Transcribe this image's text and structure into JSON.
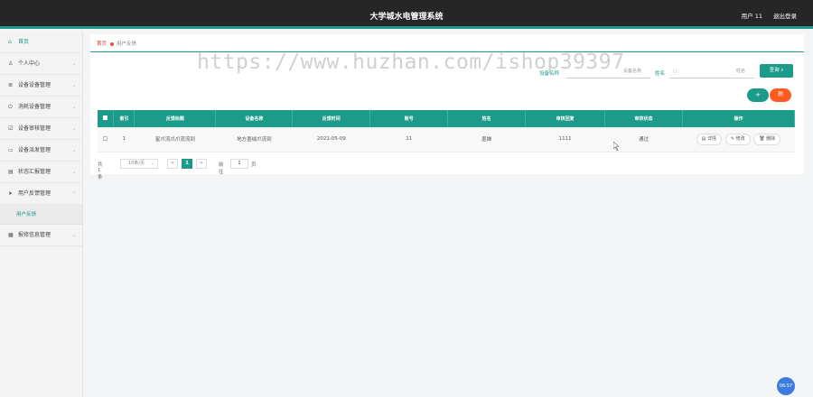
{
  "header": {
    "title": "大学城水电管理系统",
    "user": "用户 11",
    "logout": "退出登录"
  },
  "sidebar": {
    "items": [
      {
        "label": "首页",
        "icon": "home-icon"
      },
      {
        "label": "个人中心",
        "icon": "user-icon"
      },
      {
        "label": "设备设备管理",
        "icon": "list-icon"
      },
      {
        "label": "消耗设备管理",
        "icon": "power-icon"
      },
      {
        "label": "设备审核管理",
        "icon": "check-icon"
      },
      {
        "label": "设备派发管理",
        "icon": "device-icon"
      },
      {
        "label": "状态汇报管理",
        "icon": "report-icon"
      },
      {
        "label": "用户反馈管理",
        "icon": "send-icon"
      },
      {
        "label": "报修信息管理",
        "icon": "grid-icon"
      }
    ],
    "submenu": {
      "label": "用户反馈"
    }
  },
  "breadcrumb": {
    "home": "首页",
    "current": "用户反馈"
  },
  "filters": {
    "device_label": "设备名称",
    "device_placeholder": "设备名称",
    "name_label": "姓名",
    "name_placeholder": "姓名",
    "search_button": "查询"
  },
  "actions": {
    "add": "+",
    "delete": "删"
  },
  "table": {
    "headers": [
      "索引",
      "反馈标题",
      "设备名称",
      "反馈时间",
      "账号",
      "姓名",
      "审核回复",
      "审核状态",
      "操作"
    ],
    "rows": [
      {
        "index": "1",
        "title": "星爪流爪爪流流到",
        "device": "地方墨绒爪流到",
        "time": "2021-05-09",
        "account": "11",
        "name": "墨婵",
        "reply": "1111",
        "status": "通过"
      }
    ],
    "ops": {
      "detail": "详情",
      "edit": "修改",
      "delete": "删除"
    }
  },
  "pagination": {
    "total": "共 1 条",
    "page_size": "10条/页",
    "prev": "<",
    "current": "1",
    "next": ">",
    "goto_label": "前往",
    "goto_value": "1",
    "goto_suffix": "页"
  },
  "watermark": "https://www.huzhan.com/ishop39397",
  "clock": "06:57",
  "colors": {
    "accent": "#1c9a8a",
    "danger": "#ff5a1f",
    "header_bg": "#262626"
  }
}
